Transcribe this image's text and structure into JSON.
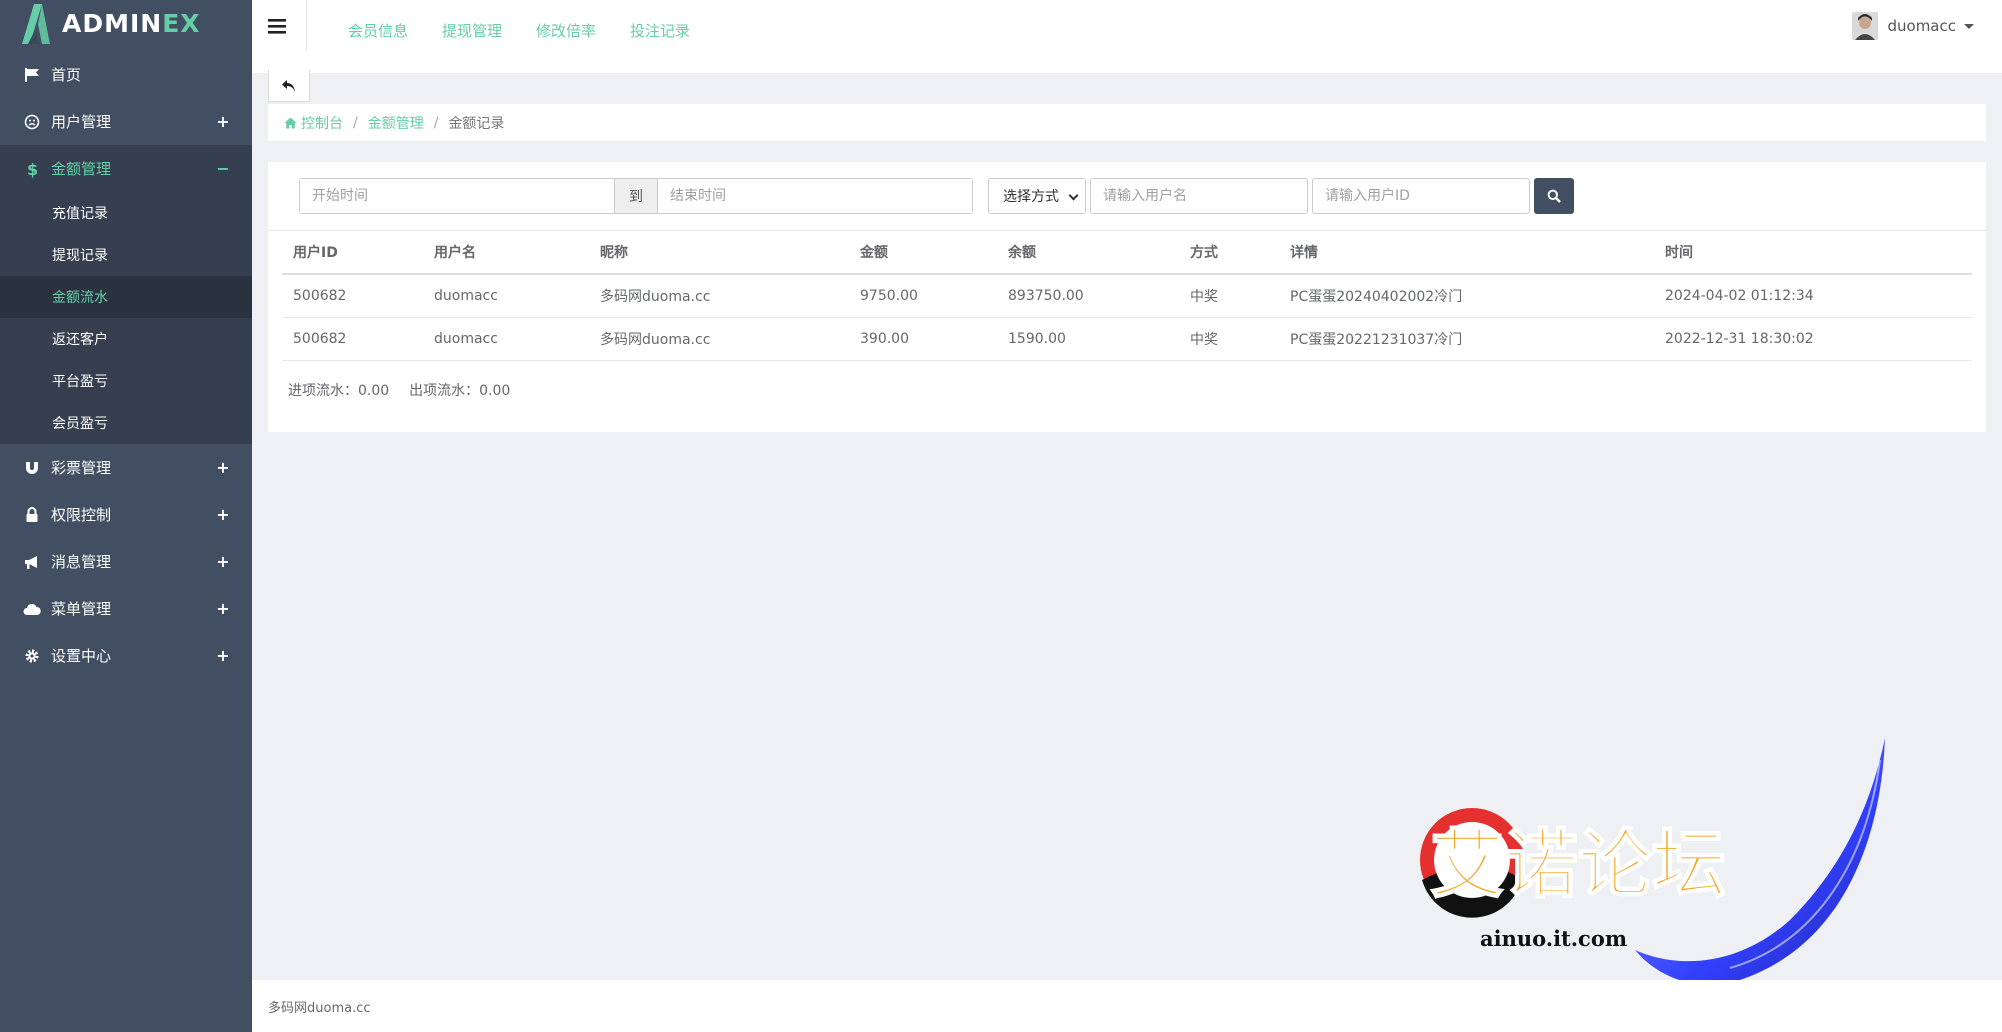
{
  "app": {
    "logo_main": "ADMIN",
    "logo_accent": "EX"
  },
  "sidebar": {
    "items": [
      {
        "label": "首页",
        "icon": "flag-icon",
        "toggle": ""
      },
      {
        "label": "用户管理",
        "icon": "user-icon",
        "toggle": "+"
      },
      {
        "label": "金额管理",
        "icon": "dollar-icon",
        "toggle": "−"
      },
      {
        "label": "彩票管理",
        "icon": "magnet-icon",
        "toggle": "+"
      },
      {
        "label": "权限控制",
        "icon": "lock-icon",
        "toggle": "+"
      },
      {
        "label": "消息管理",
        "icon": "bullhorn-icon",
        "toggle": "+"
      },
      {
        "label": "菜单管理",
        "icon": "cloud-icon",
        "toggle": "+"
      },
      {
        "label": "设置中心",
        "icon": "gear-icon",
        "toggle": "+"
      }
    ],
    "submenu": [
      "充值记录",
      "提现记录",
      "金额流水",
      "返还客户",
      "平台盈亏",
      "会员盈亏"
    ]
  },
  "topnav": [
    "会员信息",
    "提现管理",
    "修改倍率",
    "投注记录"
  ],
  "user": {
    "name": "duomacc"
  },
  "breadcrumb": {
    "home": "控制台",
    "parent": "金额管理",
    "current": "金额记录"
  },
  "filters": {
    "start_placeholder": "开始时间",
    "to_label": "到",
    "end_placeholder": "结束时间",
    "mode_value": "选择方式",
    "username_placeholder": "请输入用户名",
    "userid_placeholder": "请输入用户ID"
  },
  "table": {
    "headers": [
      "用户ID",
      "用户名",
      "昵称",
      "金额",
      "余额",
      "方式",
      "详情",
      "时间"
    ],
    "rows": [
      [
        "500682",
        "duomacc",
        "多码网duoma.cc",
        "9750.00",
        "893750.00",
        "中奖",
        "PC蛋蛋20240402002冷门",
        "2024-04-02 01:12:34"
      ],
      [
        "500682",
        "duomacc",
        "多码网duoma.cc",
        "390.00",
        "1590.00",
        "中奖",
        "PC蛋蛋20221231037冷门",
        "2022-12-31 18:30:02"
      ]
    ]
  },
  "summary": {
    "in": "进项流水：0.00",
    "out": "出项流水：0.00"
  },
  "footer": {
    "text": "多码网duoma.cc"
  },
  "watermark": {
    "title": "艾诺论坛",
    "url": "ainuo.it.com"
  },
  "colors": {
    "sidebar": "#424f63",
    "accent": "#65cea7",
    "active_bg": "#353f4f"
  }
}
